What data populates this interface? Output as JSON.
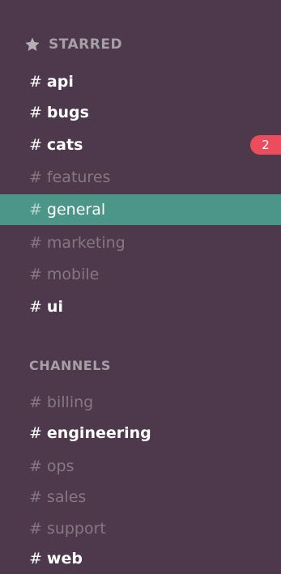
{
  "sidebar": {
    "starred": {
      "header": "STARRED",
      "icon": "star-icon",
      "channels": [
        {
          "hash": "#",
          "name": "api",
          "state": "unread"
        },
        {
          "hash": "#",
          "name": "bugs",
          "state": "unread"
        },
        {
          "hash": "#",
          "name": "cats",
          "state": "unread",
          "badge": "2"
        },
        {
          "hash": "#",
          "name": "features",
          "state": "read"
        },
        {
          "hash": "#",
          "name": "general",
          "state": "active"
        },
        {
          "hash": "#",
          "name": "marketing",
          "state": "read"
        },
        {
          "hash": "#",
          "name": "mobile",
          "state": "read"
        },
        {
          "hash": "#",
          "name": "ui",
          "state": "unread"
        }
      ]
    },
    "channels": {
      "header": "CHANNELS",
      "channels": [
        {
          "hash": "#",
          "name": "billing",
          "state": "read"
        },
        {
          "hash": "#",
          "name": "engineering",
          "state": "unread"
        },
        {
          "hash": "#",
          "name": "ops",
          "state": "read"
        },
        {
          "hash": "#",
          "name": "sales",
          "state": "read"
        },
        {
          "hash": "#",
          "name": "support",
          "state": "read"
        },
        {
          "hash": "#",
          "name": "web",
          "state": "unread"
        }
      ]
    },
    "colors": {
      "background": "#4d394b",
      "active": "#4c9689",
      "badge": "#eb4d5c",
      "unread_text": "#ffffff",
      "read_text": "#857883",
      "header_text": "#a79fa6"
    }
  }
}
